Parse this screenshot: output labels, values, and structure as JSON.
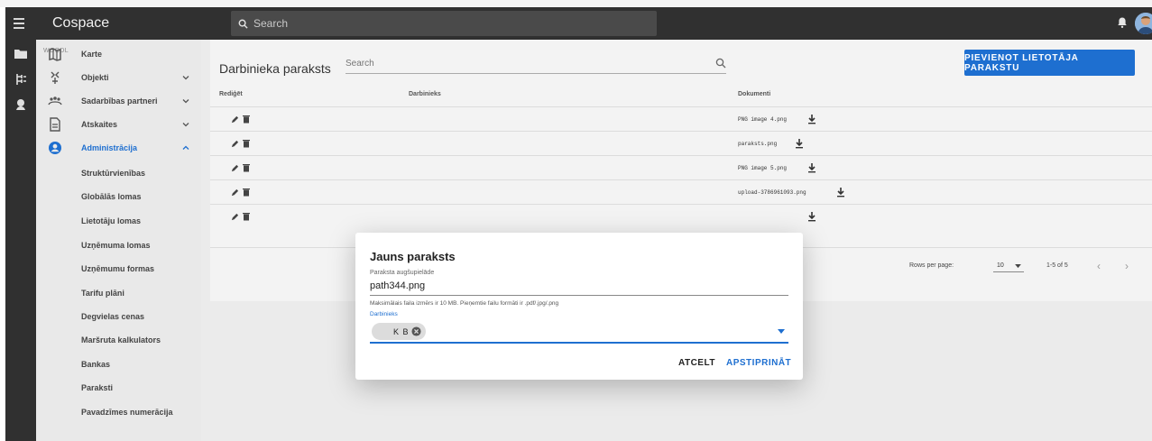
{
  "app": {
    "title": "Cospace",
    "search_placeholder": "Search"
  },
  "sidebar": {
    "section_header": "WOODL",
    "items": [
      {
        "label": "Karte",
        "icon": "map-icon",
        "expandable": false
      },
      {
        "label": "Objekti",
        "icon": "objects-icon",
        "expandable": true
      },
      {
        "label": "Sadarbības partneri",
        "icon": "partners-icon",
        "expandable": true
      },
      {
        "label": "Atskaites",
        "icon": "reports-icon",
        "expandable": true
      },
      {
        "label": "Administrācija",
        "icon": "account-circle-icon",
        "expandable": true,
        "active": true
      }
    ],
    "subitems": [
      "Struktūrvienības",
      "Globālās lomas",
      "Lietotāju lomas",
      "Uzņēmuma lomas",
      "Uzņēmumu formas",
      "Tarifu plāni",
      "Degvielas cenas",
      "Maršruta kalkulators",
      "Bankas",
      "Paraksti",
      "Pavadzīmes numerācija"
    ]
  },
  "page": {
    "title": "Darbinieka paraksts",
    "search_placeholder": "Search",
    "add_button": "PIEVIENOT LIETOTĀJA PARAKSTU"
  },
  "table": {
    "headers": [
      "Rediģēt",
      "Darbinieks",
      "Dokumenti"
    ],
    "rows": [
      {
        "document": "PNG image 4.png"
      },
      {
        "document": "paraksts.png"
      },
      {
        "document": "PNG image 5.png"
      },
      {
        "document": "upload-3786961093.png"
      },
      {
        "document": ""
      }
    ]
  },
  "pagination": {
    "rows_per_page_label": "Rows per page:",
    "rows_per_page": "10",
    "range": "1-5 of 5"
  },
  "dialog": {
    "title": "Jauns paraksts",
    "upload_label": "Paraksta augšupielāde",
    "upload_value": "path344.png",
    "help_text": "Maksimālais faila izmērs ir 10 MB. Pieņemtie failu formāti ir .pdf/.jpg/.png",
    "employee_label": "Darbinieks",
    "employee_chip": "K B",
    "cancel": "ATCELT",
    "confirm": "APSTIPRINĀT"
  },
  "colors": {
    "accent": "#1e6fd0",
    "appbar": "#303030",
    "sidebar": "#e9e9e9"
  }
}
